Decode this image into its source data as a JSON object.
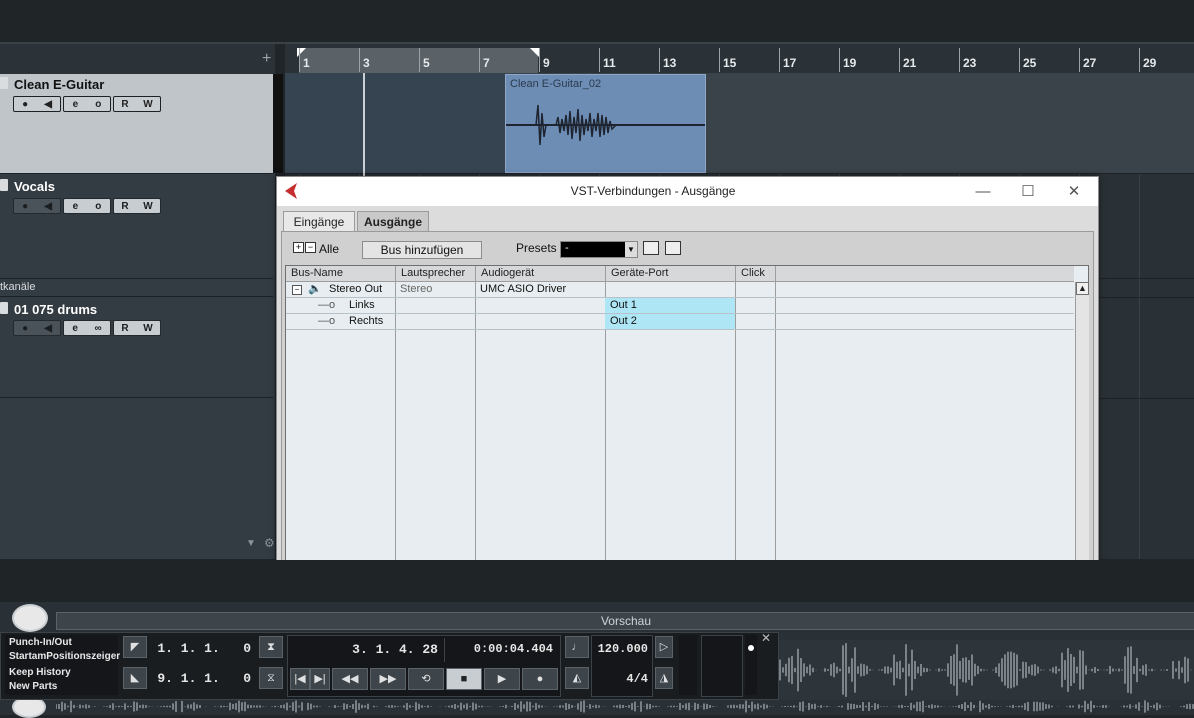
{
  "tracklist": {
    "add_label": "+",
    "tracks": [
      {
        "name": "Clean E-Guitar",
        "buttons": [
          "●",
          "◀",
          "e",
          "o",
          "R",
          "W"
        ]
      },
      {
        "name": "Vocals",
        "buttons": [
          "●",
          "◀",
          "e",
          "o",
          "R",
          "W"
        ]
      },
      {
        "name": "01 075 drums",
        "buttons": [
          "●",
          "◀",
          "e",
          "∞",
          "R",
          "W"
        ]
      }
    ],
    "folder_label": "tkanäle"
  },
  "ruler": {
    "markers": [
      "1",
      "3",
      "5",
      "7",
      "9",
      "11",
      "13",
      "15",
      "17",
      "19",
      "21",
      "23",
      "25",
      "27",
      "29"
    ]
  },
  "event": {
    "label": "Clean E-Guitar_02"
  },
  "dialog": {
    "title": "VST-Verbindungen - Ausgänge",
    "minimize": "—",
    "maximize": "☐",
    "close": "✕",
    "tabs": [
      "Eingänge",
      "Ausgänge"
    ],
    "all_label": "Alle",
    "add_bus_button": "Bus hinzufügen",
    "presets_label": "Presets",
    "presets_value": "-",
    "columns": [
      "Bus-Name",
      "Lautsprecher",
      "Audiogerät",
      "Geräte-Port",
      "Click"
    ],
    "rows": [
      {
        "name": "Stereo Out",
        "speaker": "Stereo",
        "device": "UMC ASIO Driver",
        "port": "",
        "click": ""
      },
      {
        "name": "Links",
        "speaker": "",
        "device": "",
        "port": "Out 1",
        "click": ""
      },
      {
        "name": "Rechts",
        "speaker": "",
        "device": "",
        "port": "Out 2",
        "click": ""
      }
    ]
  },
  "lower": {
    "preview_label": "Vorschau"
  },
  "transport": {
    "punch_label": "Punch-In/Out",
    "start_label": "StartamPositionszeiger",
    "keep_history": "Keep History",
    "new_parts": "New Parts",
    "left_locator": "1. 1. 1.   0",
    "right_locator": "9. 1. 1.   0",
    "position_bars": "3. 1. 4. 28",
    "position_time": "0:00:04.404",
    "tempo": "120.000",
    "signature": "4/4",
    "close_label": "✕"
  },
  "colors": {
    "accent": "#6d8db5",
    "port_highlight": "#aee6f5",
    "selected_track": "#bfc5c9"
  }
}
